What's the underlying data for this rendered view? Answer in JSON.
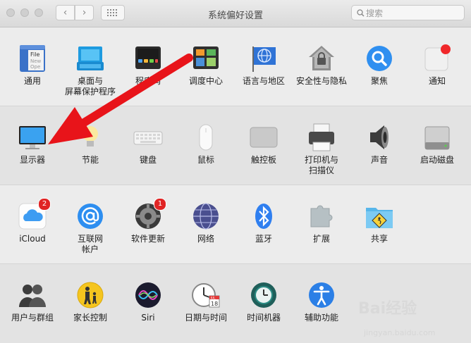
{
  "window": {
    "title": "系统偏好设置"
  },
  "toolbar": {
    "back_glyph": "‹",
    "forward_glyph": "›",
    "search_placeholder": "搜索"
  },
  "row1": [
    {
      "label": "通用"
    },
    {
      "label": "桌面与\n屏幕保护程序"
    },
    {
      "label": "程序坞"
    },
    {
      "label": "调度中心"
    },
    {
      "label": "语言与地区"
    },
    {
      "label": "安全性与隐私"
    },
    {
      "label": "聚焦"
    },
    {
      "label": "通知"
    }
  ],
  "row2": [
    {
      "label": "显示器"
    },
    {
      "label": "节能"
    },
    {
      "label": "键盘"
    },
    {
      "label": "鼠标"
    },
    {
      "label": "触控板"
    },
    {
      "label": "打印机与\n扫描仪"
    },
    {
      "label": "声音"
    },
    {
      "label": "启动磁盘"
    }
  ],
  "row3": [
    {
      "label": "iCloud",
      "badge": "2"
    },
    {
      "label": "互联网\n帐户"
    },
    {
      "label": "软件更新",
      "badge": "1"
    },
    {
      "label": "网络"
    },
    {
      "label": "蓝牙"
    },
    {
      "label": "扩展"
    },
    {
      "label": "共享"
    }
  ],
  "row4": [
    {
      "label": "用户与群组"
    },
    {
      "label": "家长控制"
    },
    {
      "label": "Siri"
    },
    {
      "label": "日期与时间"
    },
    {
      "label": "时间机器"
    },
    {
      "label": "辅助功能"
    }
  ],
  "icon_text": {
    "general_file": "File",
    "general_new": "New",
    "general_open": "Ope",
    "calendar_month": "JUL",
    "calendar_day": "18"
  },
  "watermark": {
    "text": "Bai经验",
    "url": "jingyan.baidu.com"
  },
  "colors": {
    "arrow": "#e8141a",
    "badge": "#e02424"
  }
}
